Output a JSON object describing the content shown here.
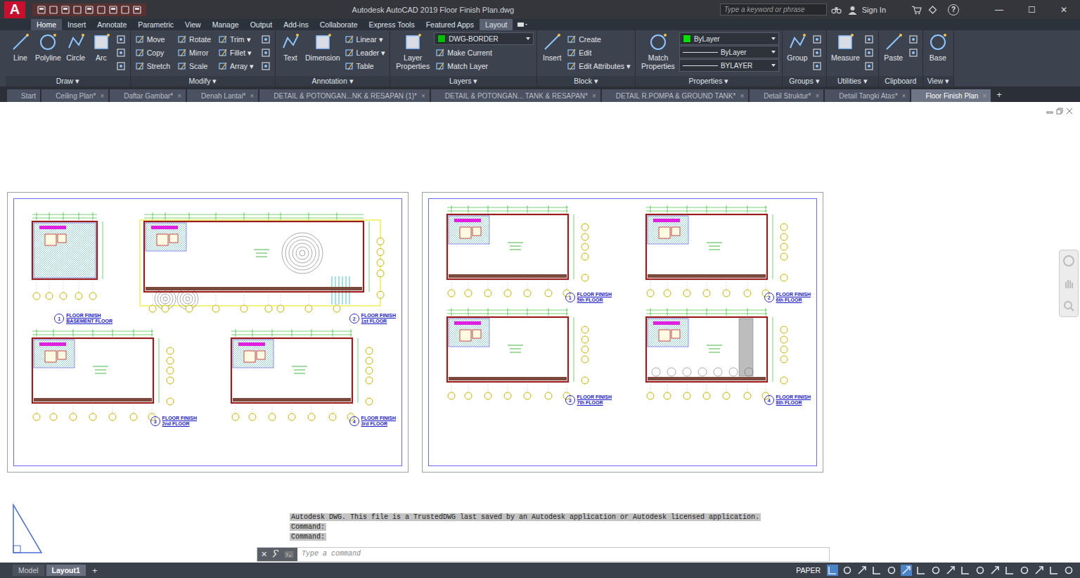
{
  "title_bar": {
    "logo": "A",
    "title": "Autodesk AutoCAD 2019    Floor Finish Plan.dwg",
    "search_placeholder": "Type a keyword or phrase",
    "sign_in": "Sign In",
    "help": "?",
    "window_controls": [
      "—",
      "☐",
      "✕"
    ]
  },
  "ribbon_tabs": [
    {
      "label": "Home",
      "selected": true,
      "contextual": false
    },
    {
      "label": "Insert",
      "selected": false,
      "contextual": false
    },
    {
      "label": "Annotate",
      "selected": false,
      "contextual": false
    },
    {
      "label": "Parametric",
      "selected": false,
      "contextual": false
    },
    {
      "label": "View",
      "selected": false,
      "contextual": false
    },
    {
      "label": "Manage",
      "selected": false,
      "contextual": false
    },
    {
      "label": "Output",
      "selected": false,
      "contextual": false
    },
    {
      "label": "Add-ins",
      "selected": false,
      "contextual": false
    },
    {
      "label": "Collaborate",
      "selected": false,
      "contextual": false
    },
    {
      "label": "Express Tools",
      "selected": false,
      "contextual": false
    },
    {
      "label": "Featured Apps",
      "selected": false,
      "contextual": false
    },
    {
      "label": "Layout",
      "selected": false,
      "contextual": true
    }
  ],
  "ribbon_groups": [
    {
      "title": "Draw ▾",
      "items": [
        {
          "kind": "large",
          "label": "Line"
        },
        {
          "kind": "large",
          "label": "Polyline"
        },
        {
          "kind": "large",
          "label": "Circle"
        },
        {
          "kind": "large",
          "label": "Arc"
        },
        {
          "kind": "icon"
        },
        {
          "kind": "icon"
        },
        {
          "kind": "icon"
        }
      ]
    },
    {
      "title": "Modify ▾",
      "items": [
        {
          "kind": "small",
          "label": "Move"
        },
        {
          "kind": "small",
          "label": "Copy"
        },
        {
          "kind": "small",
          "label": "Stretch"
        },
        {
          "kind": "small",
          "label": "Rotate"
        },
        {
          "kind": "small",
          "label": "Mirror"
        },
        {
          "kind": "small",
          "label": "Scale"
        },
        {
          "kind": "small",
          "label": "Trim ▾"
        },
        {
          "kind": "small",
          "label": "Fillet ▾"
        },
        {
          "kind": "small",
          "label": "Array ▾"
        },
        {
          "kind": "icon"
        },
        {
          "kind": "icon"
        },
        {
          "kind": "icon"
        }
      ]
    },
    {
      "title": "Annotation ▾",
      "items": [
        {
          "kind": "large",
          "label": "Text"
        },
        {
          "kind": "large",
          "label": "Dimension"
        },
        {
          "kind": "small",
          "label": "Linear ▾"
        },
        {
          "kind": "small",
          "label": "Leader ▾"
        },
        {
          "kind": "small",
          "label": "Table"
        }
      ]
    },
    {
      "title": "Layers ▾",
      "items": [
        {
          "kind": "large",
          "label": "Layer Properties"
        },
        {
          "kind": "dropdown",
          "label": "DWG-BORDER",
          "color": "#00c000"
        },
        {
          "kind": "small",
          "label": "Make Current"
        },
        {
          "kind": "small",
          "label": "Match Layer"
        }
      ]
    },
    {
      "title": "Block ▾",
      "items": [
        {
          "kind": "large",
          "label": "Insert"
        },
        {
          "kind": "small",
          "label": "Create"
        },
        {
          "kind": "small",
          "label": "Edit"
        },
        {
          "kind": "small",
          "label": "Edit Attributes ▾"
        }
      ]
    },
    {
      "title": "Properties ▾",
      "items": [
        {
          "kind": "large",
          "label": "Match Properties"
        },
        {
          "kind": "dropdown",
          "label": "ByLayer",
          "color": "#00e000"
        },
        {
          "kind": "dropdown",
          "label": "ByLayer"
        },
        {
          "kind": "dropdown",
          "label": "BYLAYER"
        }
      ]
    },
    {
      "title": "Groups ▾",
      "items": [
        {
          "kind": "large",
          "label": "Group"
        },
        {
          "kind": "icon"
        },
        {
          "kind": "icon"
        },
        {
          "kind": "icon"
        }
      ]
    },
    {
      "title": "Utilities ▾",
      "items": [
        {
          "kind": "large",
          "label": "Measure"
        },
        {
          "kind": "icon"
        },
        {
          "kind": "icon"
        },
        {
          "kind": "icon"
        }
      ]
    },
    {
      "title": "Clipboard",
      "items": [
        {
          "kind": "large",
          "label": "Paste"
        },
        {
          "kind": "icon"
        },
        {
          "kind": "icon"
        }
      ]
    },
    {
      "title": "View ▾",
      "items": [
        {
          "kind": "large",
          "label": "Base"
        }
      ]
    }
  ],
  "file_tabs": {
    "close": "×",
    "add": "+",
    "tabs": [
      {
        "label": "Start",
        "selected": false,
        "closable": false
      },
      {
        "label": "Ceiling Plan*",
        "selected": false,
        "closable": true
      },
      {
        "label": "Daftar Gambar*",
        "selected": false,
        "closable": true
      },
      {
        "label": "Denah Lantai*",
        "selected": false,
        "closable": true
      },
      {
        "label": "DETAIL & POTONGAN...NK & RESAPAN (1)*",
        "selected": false,
        "closable": true
      },
      {
        "label": "DETAIL & POTONGAN... TANK & RESAPAN*",
        "selected": false,
        "closable": true
      },
      {
        "label": "DETAIL R.POMPA & GROUND TANK*",
        "selected": false,
        "closable": true
      },
      {
        "label": "Detail Struktur*",
        "selected": false,
        "closable": true
      },
      {
        "label": "Detail Tangki Atas*",
        "selected": false,
        "closable": true
      },
      {
        "label": "Floor Finish Plan",
        "selected": true,
        "closable": true
      }
    ]
  },
  "sheets": [
    {
      "rows": [
        [
          {
            "kind": "basement",
            "number": "1",
            "title": "FLOOR FINISH",
            "subtitle": "BASEMENT FLOOR"
          },
          {
            "kind": "ground",
            "number": "2",
            "title": "FLOOR FINISH",
            "subtitle": "1st FLOOR"
          }
        ],
        [
          {
            "kind": "typical",
            "number": "3",
            "title": "FLOOR FINISH",
            "subtitle": "2nd FLOOR"
          },
          {
            "kind": "typical",
            "number": "4",
            "title": "FLOOR FINISH",
            "subtitle": "3rd FLOOR"
          }
        ]
      ]
    },
    {
      "rows": [
        [
          {
            "kind": "typical",
            "number": "1",
            "title": "FLOOR FINISH",
            "subtitle": "5th FLOOR"
          },
          {
            "kind": "typical",
            "number": "2",
            "title": "FLOOR FINISH",
            "subtitle": "6th FLOOR"
          }
        ],
        [
          {
            "kind": "typical",
            "number": "3",
            "title": "FLOOR FINISH",
            "subtitle": "7th FLOOR"
          },
          {
            "kind": "roof",
            "number": "4",
            "title": "FLOOR FINISH",
            "subtitle": "8th FLOOR"
          }
        ]
      ]
    }
  ],
  "command": {
    "history": [
      "Autodesk DWG.  This file is a TrustedDWG last saved by an Autodesk application or Autodesk licensed application.",
      "Command:",
      "Command:"
    ],
    "close": "✕",
    "placeholder": "Type a command"
  },
  "status_bar": {
    "layout_tabs": [
      {
        "label": "Model",
        "selected": false
      },
      {
        "label": "Layout1",
        "selected": true
      }
    ],
    "add": "+",
    "space": "PAPER"
  }
}
